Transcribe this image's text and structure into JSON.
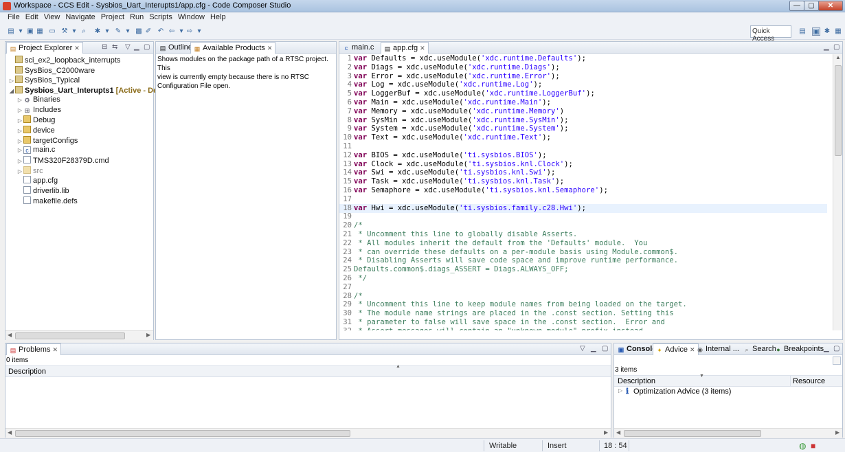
{
  "window": {
    "title": "Workspace - CCS Edit - Sysbios_Uart_Interupts1/app.cfg - Code Composer Studio"
  },
  "menu": [
    "File",
    "Edit",
    "View",
    "Navigate",
    "Project",
    "Run",
    "Scripts",
    "Window",
    "Help"
  ],
  "toolbar": {
    "quick_access_label": "Quick Access"
  },
  "project_explorer": {
    "tab_label": "Project Explorer",
    "items": [
      {
        "label": "sci_ex2_loopback_interrupts",
        "icon": "project-icon"
      },
      {
        "label": "SysBios_C2000ware",
        "icon": "project-icon"
      },
      {
        "label": "SysBios_Typical",
        "icon": "project-icon"
      },
      {
        "label": "Sysbios_Uart_Interupts1",
        "status": "[Active - Debug]",
        "icon": "project-icon"
      },
      {
        "label": "Binaries",
        "icon": "binaries-icon"
      },
      {
        "label": "Includes",
        "icon": "includes-icon"
      },
      {
        "label": "Debug",
        "icon": "folder-icon"
      },
      {
        "label": "device",
        "icon": "folder-icon"
      },
      {
        "label": "targetConfigs",
        "icon": "folder-icon"
      },
      {
        "label": "main.c",
        "icon": "c-file-icon"
      },
      {
        "label": "TMS320F28379D.cmd",
        "icon": "cmd-file-icon"
      },
      {
        "label": "src",
        "icon": "folder-icon"
      },
      {
        "label": "app.cfg",
        "icon": "cfg-file-icon"
      },
      {
        "label": "driverlib.lib",
        "icon": "lib-file-icon"
      },
      {
        "label": "makefile.defs",
        "icon": "file-icon"
      }
    ]
  },
  "outline_panel": {
    "tabs": [
      "Outline",
      "Available Products"
    ],
    "message_lines": [
      "Shows modules on the package path of a RTSC project. This",
      "view is currently empty because there is no RTSC",
      "Configuration File open."
    ]
  },
  "editor": {
    "tabs": [
      "main.c",
      "app.cfg"
    ],
    "active_tab": "app.cfg",
    "lines": [
      {
        "n": "1",
        "kw": "var",
        "text": " Defaults = xdc.useModule(",
        "str": "'xdc.runtime.Defaults'",
        "tail": ");"
      },
      {
        "n": "2",
        "kw": "var",
        "text": " Diags = xdc.useModule(",
        "str": "'xdc.runtime.Diags'",
        "tail": ");"
      },
      {
        "n": "3",
        "kw": "var",
        "text": " Error = xdc.useModule(",
        "str": "'xdc.runtime.Error'",
        "tail": ");"
      },
      {
        "n": "4",
        "kw": "var",
        "text": " Log = xdc.useModule(",
        "str": "'xdc.runtime.Log'",
        "tail": ");"
      },
      {
        "n": "5",
        "kw": "var",
        "text": " LoggerBuf = xdc.useModule(",
        "str": "'xdc.runtime.LoggerBuf'",
        "tail": ");"
      },
      {
        "n": "6",
        "kw": "var",
        "text": " Main = xdc.useModule(",
        "str": "'xdc.runtime.Main'",
        "tail": ");"
      },
      {
        "n": "7",
        "kw": "var",
        "text": " Memory = xdc.useModule(",
        "str": "'xdc.runtime.Memory'",
        "tail": ")"
      },
      {
        "n": "8",
        "kw": "var",
        "text": " SysMin = xdc.useModule(",
        "str": "'xdc.runtime.SysMin'",
        "tail": ");"
      },
      {
        "n": "9",
        "kw": "var",
        "text": " System = xdc.useModule(",
        "str": "'xdc.runtime.System'",
        "tail": ");"
      },
      {
        "n": "10",
        "kw": "var",
        "text": " Text = xdc.useModule(",
        "str": "'xdc.runtime.Text'",
        "tail": ");"
      },
      {
        "n": "11",
        "kw": "",
        "text": "",
        "str": "",
        "tail": ""
      },
      {
        "n": "12",
        "kw": "var",
        "text": " BIOS = xdc.useModule(",
        "str": "'ti.sysbios.BIOS'",
        "tail": ");"
      },
      {
        "n": "13",
        "kw": "var",
        "text": " Clock = xdc.useModule(",
        "str": "'ti.sysbios.knl.Clock'",
        "tail": ");"
      },
      {
        "n": "14",
        "kw": "var",
        "text": " Swi = xdc.useModule(",
        "str": "'ti.sysbios.knl.Swi'",
        "tail": ");"
      },
      {
        "n": "15",
        "kw": "var",
        "text": " Task = xdc.useModule(",
        "str": "'ti.sysbios.knl.Task'",
        "tail": ");"
      },
      {
        "n": "16",
        "kw": "var",
        "text": " Semaphore = xdc.useModule(",
        "str": "'ti.sysbios.knl.Semaphore'",
        "tail": ");"
      },
      {
        "n": "17",
        "kw": "",
        "text": "",
        "str": "",
        "tail": ""
      },
      {
        "n": "18",
        "kw": "var",
        "text": " Hwi = xdc.useModule(",
        "str": "'ti.sysbios.family.c28.Hwi'",
        "tail": ");",
        "highlight": true
      },
      {
        "n": "19",
        "kw": "",
        "text": "",
        "str": "",
        "tail": ""
      },
      {
        "n": "20",
        "cm": "/*"
      },
      {
        "n": "21",
        "cm": " * Uncomment this line to globally disable Asserts."
      },
      {
        "n": "22",
        "cm": " * All modules inherit the default from the 'Defaults' module.  You"
      },
      {
        "n": "23",
        "cm": " * can override these defaults on a per-module basis using Module.common$."
      },
      {
        "n": "24",
        "cm": " * Disabling Asserts will save code space and improve runtime performance."
      },
      {
        "n": "25",
        "cm": "Defaults.common$.diags_ASSERT = Diags.ALWAYS_OFF;"
      },
      {
        "n": "26",
        "cm": " */"
      },
      {
        "n": "27",
        "kw": "",
        "text": "",
        "str": "",
        "tail": ""
      },
      {
        "n": "28",
        "cm": "/*"
      },
      {
        "n": "29",
        "cm": " * Uncomment this line to keep module names from being loaded on the target."
      },
      {
        "n": "30",
        "cm": " * The module name strings are placed in the .const section. Setting this"
      },
      {
        "n": "31",
        "cm": " * parameter to false will save space in the .const section.  Error and"
      },
      {
        "n": "32",
        "cm": " * Assert messages will contain an \"unknown module\" prefix instead"
      }
    ]
  },
  "problems": {
    "tab_label": "Problems",
    "count_label": "0 items",
    "column": "Description"
  },
  "advice": {
    "tabs": [
      "Console",
      "Advice",
      "Internal ...",
      "Search",
      "Breakpoints"
    ],
    "count_label": "3 items",
    "columns": [
      "Description",
      "Resource"
    ],
    "row": "Optimization Advice (3 items)"
  },
  "status": {
    "writable": "Writable",
    "insert": "Insert",
    "position": "18 : 54"
  }
}
